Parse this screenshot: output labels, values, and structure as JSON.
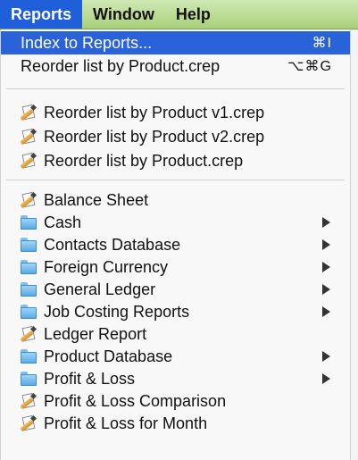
{
  "menubar": {
    "reports": "Reports",
    "window": "Window",
    "help": "Help"
  },
  "menu": {
    "top": [
      {
        "label": "Index to Reports...",
        "shortcut": "⌘I"
      },
      {
        "label": "Reorder list by Product.crep",
        "shortcut": "⌥⌘G"
      }
    ],
    "recent": [
      {
        "label": "Reorder list by Product v1.crep"
      },
      {
        "label": "Reorder list by Product v2.crep"
      },
      {
        "label": "Reorder list by Product.crep"
      }
    ],
    "reports": [
      {
        "label": "Balance Sheet",
        "icon": "report-icon"
      },
      {
        "label": "Cash",
        "icon": "folder-icon",
        "submenu": true
      },
      {
        "label": "Contacts Database",
        "icon": "folder-icon",
        "submenu": true
      },
      {
        "label": "Foreign Currency",
        "icon": "folder-icon",
        "submenu": true
      },
      {
        "label": "General Ledger",
        "icon": "folder-icon",
        "submenu": true
      },
      {
        "label": "Job Costing Reports",
        "icon": "folder-icon",
        "submenu": true
      },
      {
        "label": "Ledger Report",
        "icon": "report-icon"
      },
      {
        "label": "Product Database",
        "icon": "folder-icon",
        "submenu": true
      },
      {
        "label": "Profit & Loss",
        "icon": "folder-icon",
        "submenu": true
      },
      {
        "label": "Profit & Loss Comparison",
        "icon": "report-icon"
      },
      {
        "label": "Profit & Loss for Month",
        "icon": "report-icon"
      }
    ]
  }
}
